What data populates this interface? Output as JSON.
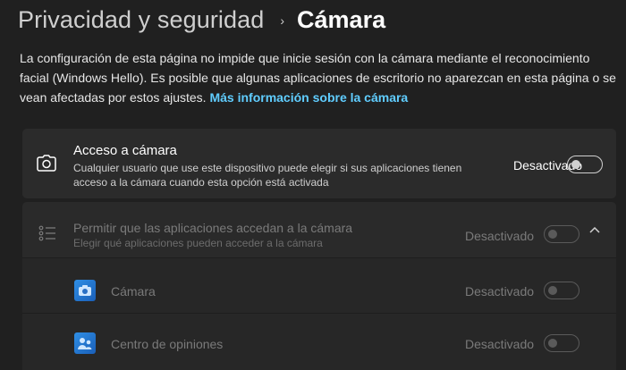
{
  "breadcrumb": {
    "parent": "Privacidad y seguridad",
    "separator": "›",
    "current": "Cámara"
  },
  "description": {
    "text": "La configuración de esta página no impide que inicie sesión con la cámara mediante el reconocimiento facial (Windows Hello). Es posible que algunas aplicaciones de escritorio no aparezcan en esta página o se vean afectadas por estos ajustes.",
    "link": "Más información sobre la cámara"
  },
  "camera_access": {
    "icon": "camera-icon",
    "title": "Acceso a cámara",
    "subtitle": "Cualquier usuario que use este dispositivo puede elegir si sus aplicaciones tienen acceso a la cámara cuando esta opción está activada",
    "status": "Desactivado",
    "enabled": false
  },
  "app_access": {
    "icon": "list-icon",
    "title": "Permitir que las aplicaciones accedan a la cámara",
    "subtitle": "Elegir qué aplicaciones pueden acceder a la cámara",
    "status": "Desactivado",
    "enabled": false,
    "expand_icon": "chevron-up-icon"
  },
  "apps": [
    {
      "name": "Cámara",
      "icon": "camera-app-icon",
      "status": "Desactivado",
      "enabled": false
    },
    {
      "name": "Centro de opiniones",
      "icon": "feedback-hub-icon",
      "status": "Desactivado",
      "enabled": false
    }
  ],
  "colors": {
    "background": "#202020",
    "card": "#2b2b2b",
    "link": "#60cdff",
    "app_icon": "#2f8fe6"
  }
}
